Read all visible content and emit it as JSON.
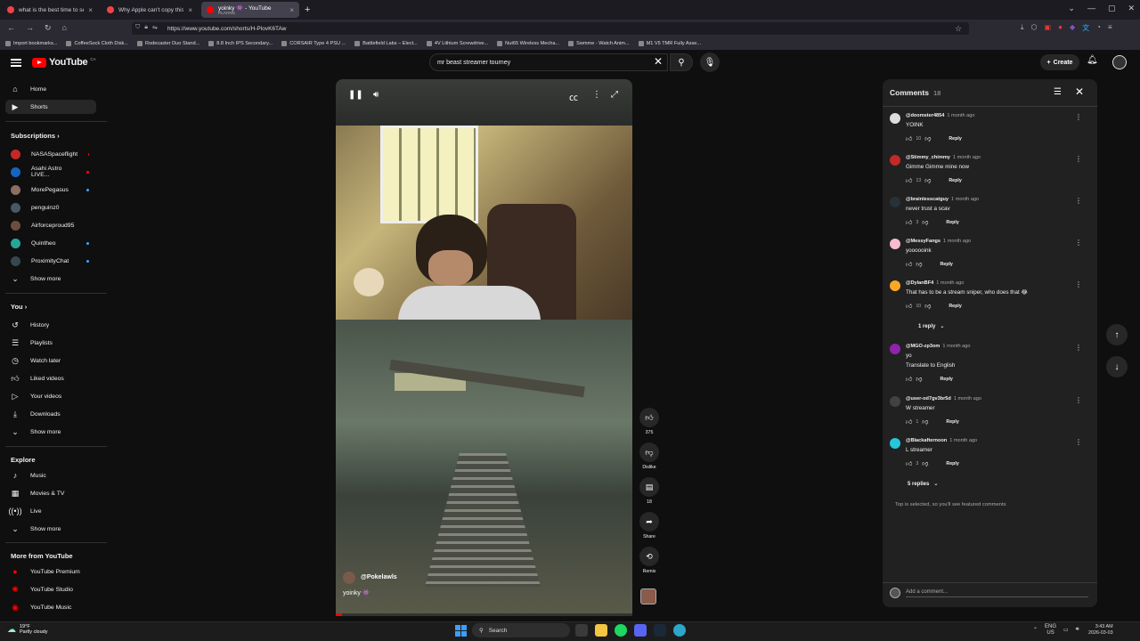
{
  "browser": {
    "tabs": [
      {
        "title": "what is the best time to see the",
        "active": false
      },
      {
        "title": "Why Apple can't copy this Sams",
        "active": false
      },
      {
        "title": "yoinky 👾 - YouTube",
        "sub": "PLAYING",
        "active": true
      }
    ],
    "url": "https://www.youtube.com/shorts/H-PlovK6TAw",
    "bookmarks": [
      "Import bookmarks...",
      "CoffeeSock Cloth Disk...",
      "Rodecaster Duo Stand...",
      "8.8 Inch IPS Secondary...",
      "CORSAIR Type 4 PSU ...",
      "Battlefield Labs – Elect...",
      "4V Lithium Screwdrive...",
      "Nut65 Wireless Mecha...",
      "Swmme - Watch Anim...",
      "M1 V5 TMR Fully Asse..."
    ]
  },
  "header": {
    "logo_text": "YouTube",
    "country": "CA",
    "search_value": "mr beast streamer tourney",
    "create_label": "Create"
  },
  "sidebar": {
    "main": [
      {
        "label": "Home",
        "icon": "home-icon"
      },
      {
        "label": "Shorts",
        "icon": "shorts-icon",
        "active": true
      }
    ],
    "subscriptions_title": "Subscriptions",
    "subscriptions": [
      {
        "label": "NASASpaceflight",
        "color": "#c62828",
        "badge": "live"
      },
      {
        "label": "Asahi Astro LIVE...",
        "color": "#1565c0",
        "badge": "live"
      },
      {
        "label": "MorePegasus",
        "color": "#8d6e63",
        "badge": "dot"
      },
      {
        "label": "penguinz0",
        "color": "#455a64",
        "badge": "none"
      },
      {
        "label": "Airforceproud95",
        "color": "#6d4c41",
        "badge": "none"
      },
      {
        "label": "Quintheo",
        "color": "#26a69a",
        "badge": "dot"
      },
      {
        "label": "ProximityChat",
        "color": "#37474f",
        "badge": "dot"
      }
    ],
    "show_more": "Show more",
    "you_title": "You",
    "you": [
      {
        "label": "History",
        "icon": "history-icon"
      },
      {
        "label": "Playlists",
        "icon": "playlists-icon"
      },
      {
        "label": "Watch later",
        "icon": "watch-later-icon"
      },
      {
        "label": "Liked videos",
        "icon": "liked-icon"
      },
      {
        "label": "Your videos",
        "icon": "your-videos-icon"
      },
      {
        "label": "Downloads",
        "icon": "downloads-icon"
      }
    ],
    "explore_title": "Explore",
    "explore": [
      {
        "label": "Music",
        "icon": "music-icon"
      },
      {
        "label": "Movies & TV",
        "icon": "movies-icon"
      },
      {
        "label": "Live",
        "icon": "live-icon"
      }
    ],
    "more_title": "More from YouTube",
    "more": [
      {
        "label": "YouTube Premium"
      },
      {
        "label": "YouTube Studio"
      },
      {
        "label": "YouTube Music"
      }
    ]
  },
  "short": {
    "author": "@Pokelawls",
    "title": "yoinky 👾",
    "progress": 0.02
  },
  "actions": {
    "likes": "375",
    "dislike": "Dislike",
    "comments": "18",
    "share": "Share",
    "remix": "Remix"
  },
  "comments_panel": {
    "title": "Comments",
    "count": "18",
    "items": [
      {
        "user": "@doomster4854",
        "time": "1 month ago",
        "text": "YOINK",
        "likes": "10",
        "color": "#ddd"
      },
      {
        "user": "@Stimmy_chimmy",
        "time": "1 month ago",
        "text": "Gimme Gimme  mine now",
        "likes": "13",
        "color": "#c62828"
      },
      {
        "user": "@brainlesscatguy",
        "time": "1 month ago",
        "text": "never trust a scav",
        "likes": "3",
        "color": "#263238"
      },
      {
        "user": "@MessyFangs",
        "time": "1 month ago",
        "text": "yoooooink",
        "likes": "",
        "color": "#f8bbd0"
      },
      {
        "user": "@DylanBF4",
        "time": "1 month ago",
        "text": "That has to be a stream sniper, who does that 😂",
        "likes": "10",
        "color": "#f9a825"
      },
      {
        "user": "@MGO-zp3om",
        "time": "1 month ago",
        "text": "yo",
        "likes": "",
        "color": "#8e24aa",
        "translate": "Translate to English"
      },
      {
        "user": "@user-od7gv3br5d",
        "time": "1 month ago",
        "text": "W streamer",
        "likes": "1",
        "color": "#424242"
      },
      {
        "user": "@Blackafternoon",
        "time": "1 month ago",
        "text": "L streamer",
        "likes": "3",
        "color": "#26c6da"
      }
    ],
    "reply_label": "Reply",
    "replies_1": "1 reply",
    "replies_2": "5 replies",
    "footer_note": "Top is selected, so you'll see featured comments",
    "add_placeholder": "Add a comment..."
  },
  "taskbar": {
    "temp": "19°F",
    "weather": "Partly cloudy",
    "search": "Search",
    "lang": "ENG",
    "region": "US",
    "time": "3:43 AM",
    "date": "2026-03-03"
  }
}
